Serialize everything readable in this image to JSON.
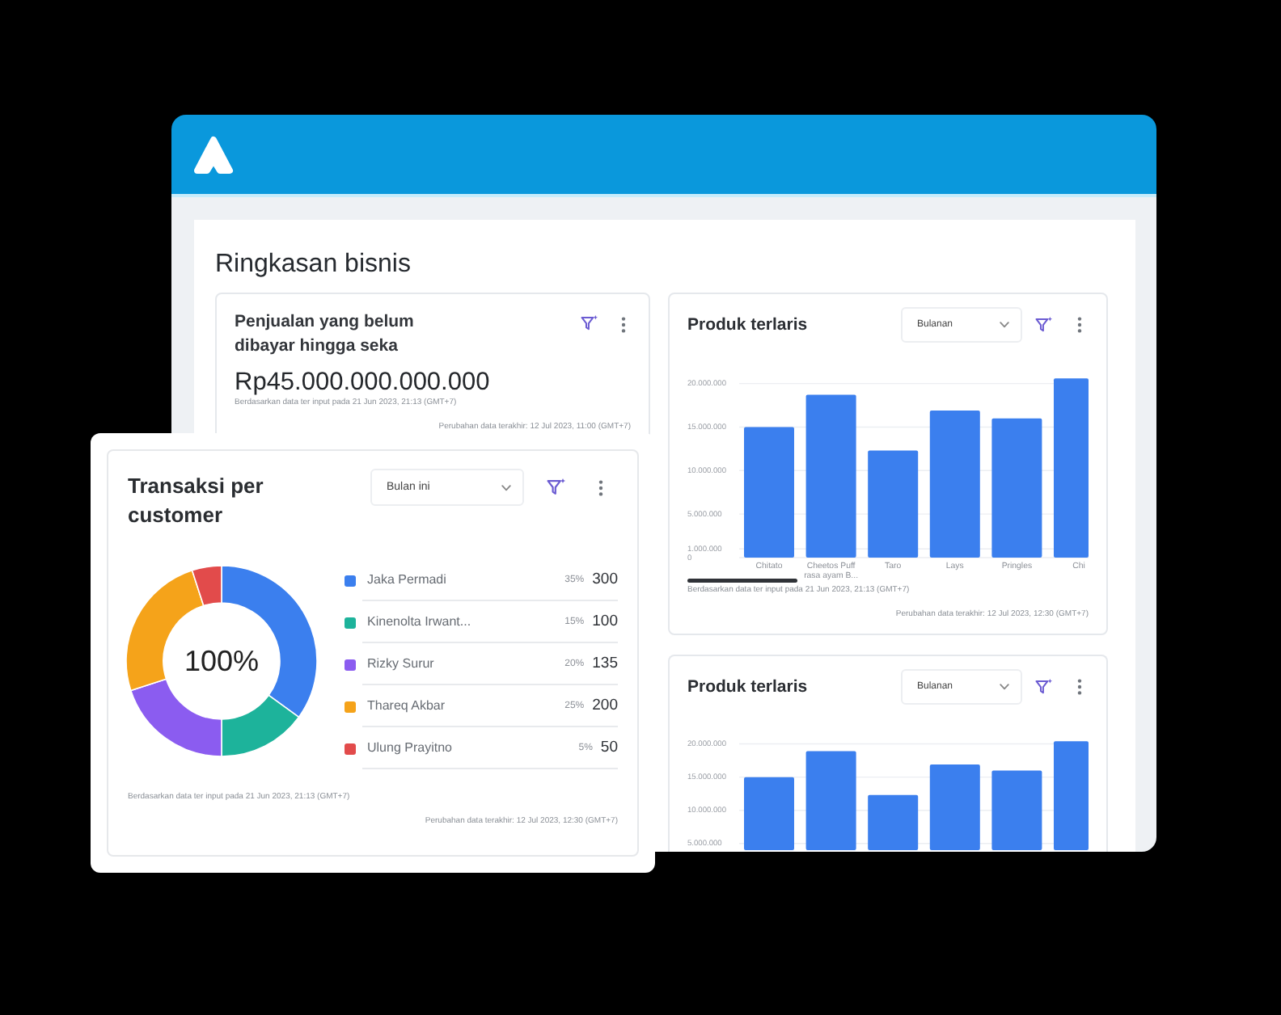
{
  "page": {
    "title": "Ringkasan bisnis"
  },
  "unpaid_sales": {
    "title": "Penjualan yang belum dibayar hingga seka",
    "amount": "Rp45.000.000.000.000",
    "input_note": "Berdasarkan data ter input pada 21 Jun 2023, 21:13 (GMT+7)",
    "updated_note": "Perubahan data terakhir: 12 Jul 2023, 11:00 (GMT+7)"
  },
  "best_sellers": [
    {
      "title": "Produk terlaris",
      "period": "Bulanan",
      "chart_data": {
        "type": "bar",
        "categories": [
          "Chitato",
          "Cheetos Puff rasa ayam B...",
          "Taro",
          "Lays",
          "Pringles",
          "Chi"
        ],
        "series": [
          {
            "color": "#3b7fee",
            "values": [
              15000000,
              18700000,
              12300000,
              16900000,
              16000000,
              20600000
            ]
          }
        ],
        "ylim": [
          0,
          20800000
        ],
        "yticks": [
          {
            "value": 20000000,
            "label": "20.000.000"
          },
          {
            "value": 15000000,
            "label": "15.000.000"
          },
          {
            "value": 10000000,
            "label": "10.000.000"
          },
          {
            "value": 5000000,
            "label": "5.000.000"
          },
          {
            "value": 1000000,
            "label": "1.000.000"
          },
          {
            "value": 0,
            "label": "0"
          }
        ],
        "grid": true
      },
      "input_note": "Berdasarkan data ter input pada 21 Jun 2023, 21:13 (GMT+7)",
      "updated_note": "Perubahan data terakhir: 12 Jul 2023, 12:30 (GMT+7)"
    },
    {
      "title": "Produk terlaris",
      "period": "Bulanan",
      "chart_data": {
        "type": "bar",
        "series": [
          {
            "color": "#3b7fee",
            "values": [
              15000000,
              18900000,
              12300000,
              16900000,
              16000000,
              20400000
            ]
          }
        ],
        "ylim": [
          4000000,
          20800000
        ],
        "yticks": [
          {
            "value": 20000000,
            "label": "20.000.000"
          },
          {
            "value": 15000000,
            "label": "15.000.000"
          },
          {
            "value": 10000000,
            "label": "10.000.000"
          },
          {
            "value": 5000000,
            "label": "5.000.000"
          }
        ],
        "grid": true
      }
    }
  ],
  "customer_transactions": {
    "title": "Transaksi per customer",
    "period": "Bulan ini",
    "chart_data": {
      "type": "donut",
      "values": [
        35,
        15,
        20,
        25,
        5
      ]
    },
    "center_label": "100%",
    "legend": [
      {
        "name": "Jaka Permadi",
        "share": "35%",
        "count": "300",
        "color": "#3b7fee"
      },
      {
        "name": "Kinenolta Irwant...",
        "share": "15%",
        "count": "100",
        "color": "#1db39b"
      },
      {
        "name": "Rizky Surur",
        "share": "20%",
        "count": "135",
        "color": "#8b5cf0"
      },
      {
        "name": "Thareq Akbar",
        "share": "25%",
        "count": "200",
        "color": "#f5a31a"
      },
      {
        "name": "Ulung Prayitno",
        "share": "5%",
        "count": "50",
        "color": "#e24b4b"
      }
    ],
    "input_note": "Berdasarkan data ter input pada 21 Jun 2023, 21:13 (GMT+7)",
    "updated_note": "Perubahan data terakhir: 12 Jul 2023, 12:30 (GMT+7)"
  }
}
